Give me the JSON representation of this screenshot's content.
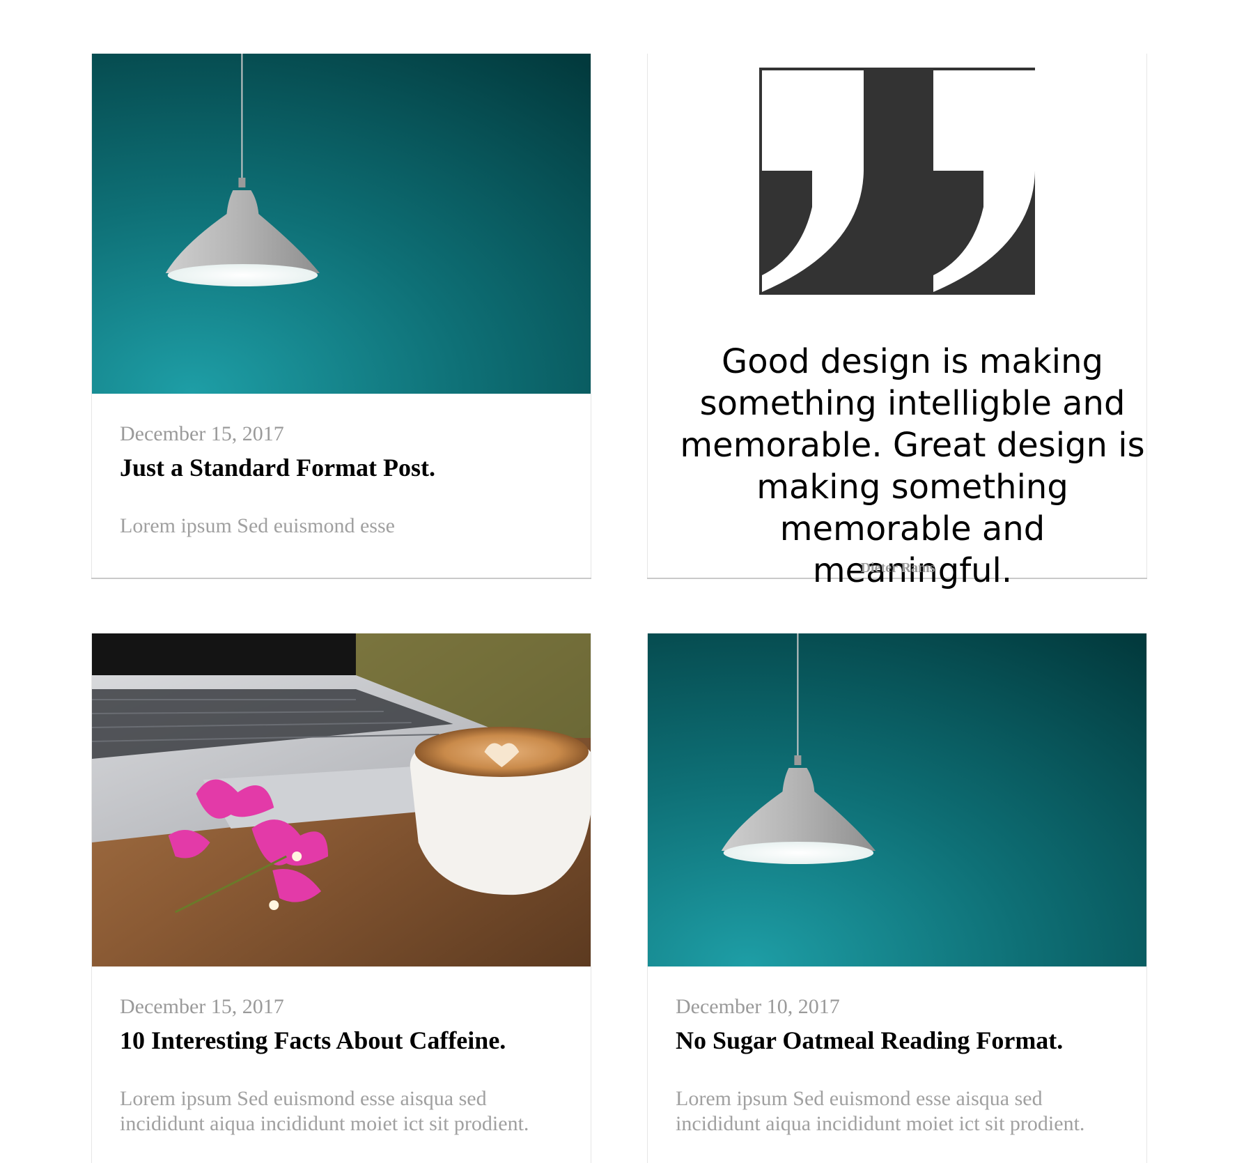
{
  "posts": [
    {
      "date": "December 15, 2017",
      "title": "Just a Standard Format Post.",
      "excerpt": "Lorem ipsum Sed euismond esse"
    },
    {
      "quote": "Good design is making something intelligble and memorable. Great design is making something memorable and meaningful.",
      "author": "Dieter Rams"
    },
    {
      "date": "December 15, 2017",
      "title": "10 Interesting Facts About Caffeine.",
      "excerpt": "Lorem ipsum Sed euismond esse aisqua sed incididunt aiqua incididunt moiet ict sit prodient."
    },
    {
      "date": "December 10, 2017",
      "title": "No Sugar Oatmeal Reading Format.",
      "excerpt": "Lorem ipsum Sed euismond esse aisqua sed incididunt aiqua incididunt moiet ict sit prodient."
    }
  ],
  "icons": {
    "post_1_thumb": "pendant-lamp-image",
    "post_2_thumb": "quote-mark-icon",
    "post_3_thumb": "laptop-coffee-flowers-image",
    "post_4_thumb": "pendant-lamp-image"
  },
  "colors": {
    "background": "#ffffff",
    "date": "#9a9a9a",
    "title": "#000000",
    "excerpt": "#a0a0a0",
    "teal_wall": "#0e6b6f",
    "quote_mark_bg": "#333333"
  }
}
